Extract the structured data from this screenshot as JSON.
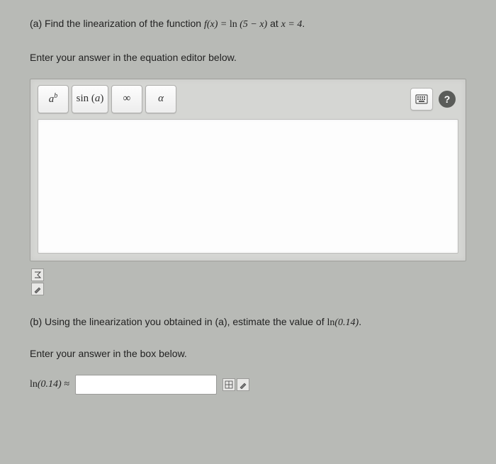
{
  "partA": {
    "label": "(a)",
    "prompt_pre": "Find the linearization of the function ",
    "function_tex": "f(x) = ln (5 − x)",
    "prompt_mid": " at ",
    "point_tex": "x = 4",
    "suffix": ".",
    "instruction": "Enter your answer in the equation editor below."
  },
  "toolbar": {
    "buttons": [
      {
        "name": "exponent-button",
        "label_html": "a<sup>b</sup>"
      },
      {
        "name": "trig-button",
        "label_html": "sin (a)"
      },
      {
        "name": "infinity-button",
        "label_html": "∞"
      },
      {
        "name": "alpha-button",
        "label_html": "α"
      }
    ],
    "keyboard": {
      "name": "keyboard-button"
    },
    "help": {
      "name": "help-button",
      "label": "?"
    }
  },
  "belowIcons": [
    {
      "name": "equation-tool-1",
      "glyph": "Σ"
    },
    {
      "name": "equation-tool-2",
      "glyph": "✎"
    }
  ],
  "partB": {
    "label": "(b)",
    "prompt_pre": "Using the linearization you obtained in (a), estimate the value of ",
    "target_tex": "ln(0.14)",
    "suffix": ".",
    "instruction": "Enter your answer in the box below.",
    "answer_prefix": "ln(0.14) ≈",
    "input_value": ""
  },
  "rowIcons": [
    {
      "name": "calc-tool-1",
      "glyph": "▦"
    },
    {
      "name": "calc-tool-2",
      "glyph": "✎"
    }
  ]
}
